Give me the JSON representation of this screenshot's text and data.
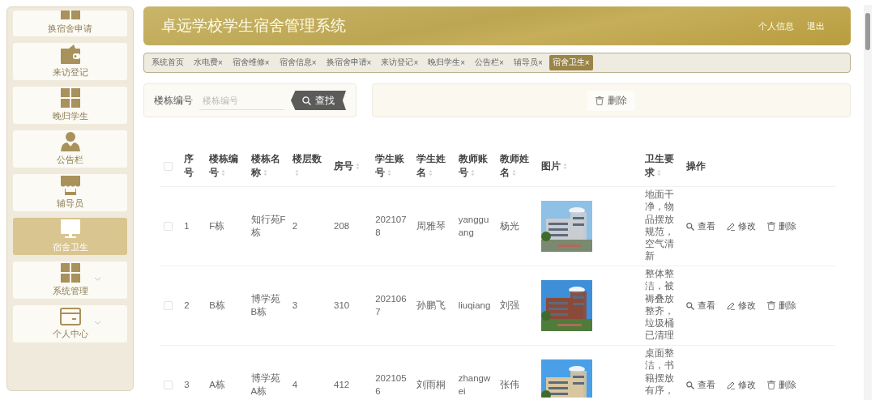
{
  "sidebar": {
    "items": [
      {
        "label": "换宿舍申请",
        "selected": false,
        "expandable": false
      },
      {
        "label": "来访登记",
        "selected": false,
        "expandable": false
      },
      {
        "label": "晚归学生",
        "selected": false,
        "expandable": false
      },
      {
        "label": "公告栏",
        "selected": false,
        "expandable": false
      },
      {
        "label": "辅导员",
        "selected": false,
        "expandable": false
      },
      {
        "label": "宿舍卫生",
        "selected": true,
        "expandable": false
      },
      {
        "label": "系统管理",
        "selected": false,
        "expandable": true
      },
      {
        "label": "个人中心",
        "selected": false,
        "expandable": true
      }
    ]
  },
  "header": {
    "title": "卓远学校学生宿舍管理系统",
    "links": [
      "个人信息",
      "退出"
    ]
  },
  "tabs": [
    {
      "label": "系统首页",
      "selected": false
    },
    {
      "label": "水电费",
      "close": "×",
      "selected": false
    },
    {
      "label": "宿舍维修",
      "close": "×",
      "selected": false
    },
    {
      "label": "宿舍信息",
      "close": "×",
      "selected": false
    },
    {
      "label": "换宿舍申请",
      "close": "×",
      "selected": false
    },
    {
      "label": "来访登记",
      "close": "×",
      "selected": false
    },
    {
      "label": "晚归学生",
      "close": "×",
      "selected": false
    },
    {
      "label": "公告栏",
      "close": "×",
      "selected": false
    },
    {
      "label": "辅导员",
      "close": "×",
      "selected": false
    },
    {
      "label": "宿舍卫生",
      "close": "×",
      "selected": true
    }
  ],
  "search": {
    "label": "楼栋编号",
    "placeholder": "楼栋编号",
    "button": "查找"
  },
  "delete_button": "删除",
  "table": {
    "select_all": {
      "checked": false
    },
    "columns": [
      {
        "label": "序号",
        "sortable": false
      },
      {
        "label": "楼栋编号",
        "sortable": true
      },
      {
        "label": "楼栋名称",
        "sortable": true
      },
      {
        "label": "楼层数",
        "sortable": true
      },
      {
        "label": "房号",
        "sortable": true
      },
      {
        "label": "学生账号",
        "sortable": true
      },
      {
        "label": "学生姓名",
        "sortable": true
      },
      {
        "label": "教师账号",
        "sortable": true
      },
      {
        "label": "教师姓名",
        "sortable": true
      },
      {
        "label": "图片",
        "sortable": true
      },
      {
        "label": "卫生要求",
        "sortable": true
      },
      {
        "label": "操作",
        "sortable": false
      }
    ],
    "rows": [
      {
        "checked": false,
        "cells": [
          "1",
          "F栋",
          "知行苑F栋",
          "2",
          "208",
          "2021078",
          "周雅琴",
          "yangguang",
          "杨光"
        ],
        "picture": {
          "kind": "picture"
        },
        "requirement": "地面干净，物品摆放规范，空气清新",
        "actions": [
          "查看",
          "修改",
          "删除"
        ]
      },
      {
        "checked": false,
        "cells": [
          "2",
          "B栋",
          "博学苑B栋",
          "3",
          "310",
          "2021067",
          "孙鹏飞",
          "liuqiang",
          "刘强"
        ],
        "picture": {
          "kind": "picture"
        },
        "requirement": "整体整洁，被褥叠放整齐，垃圾桶已清理",
        "actions": [
          "查看",
          "修改",
          "删除"
        ]
      },
      {
        "checked": false,
        "cells": [
          "3",
          "A栋",
          "博学苑A栋",
          "4",
          "412",
          "2021056",
          "刘雨桐",
          "zhangwei",
          "张伟"
        ],
        "picture": {
          "kind": "picture"
        },
        "requirement": "桌面整洁，书籍摆放有序，",
        "actions": [
          "查看",
          "修改",
          "删除"
        ]
      }
    ]
  }
}
